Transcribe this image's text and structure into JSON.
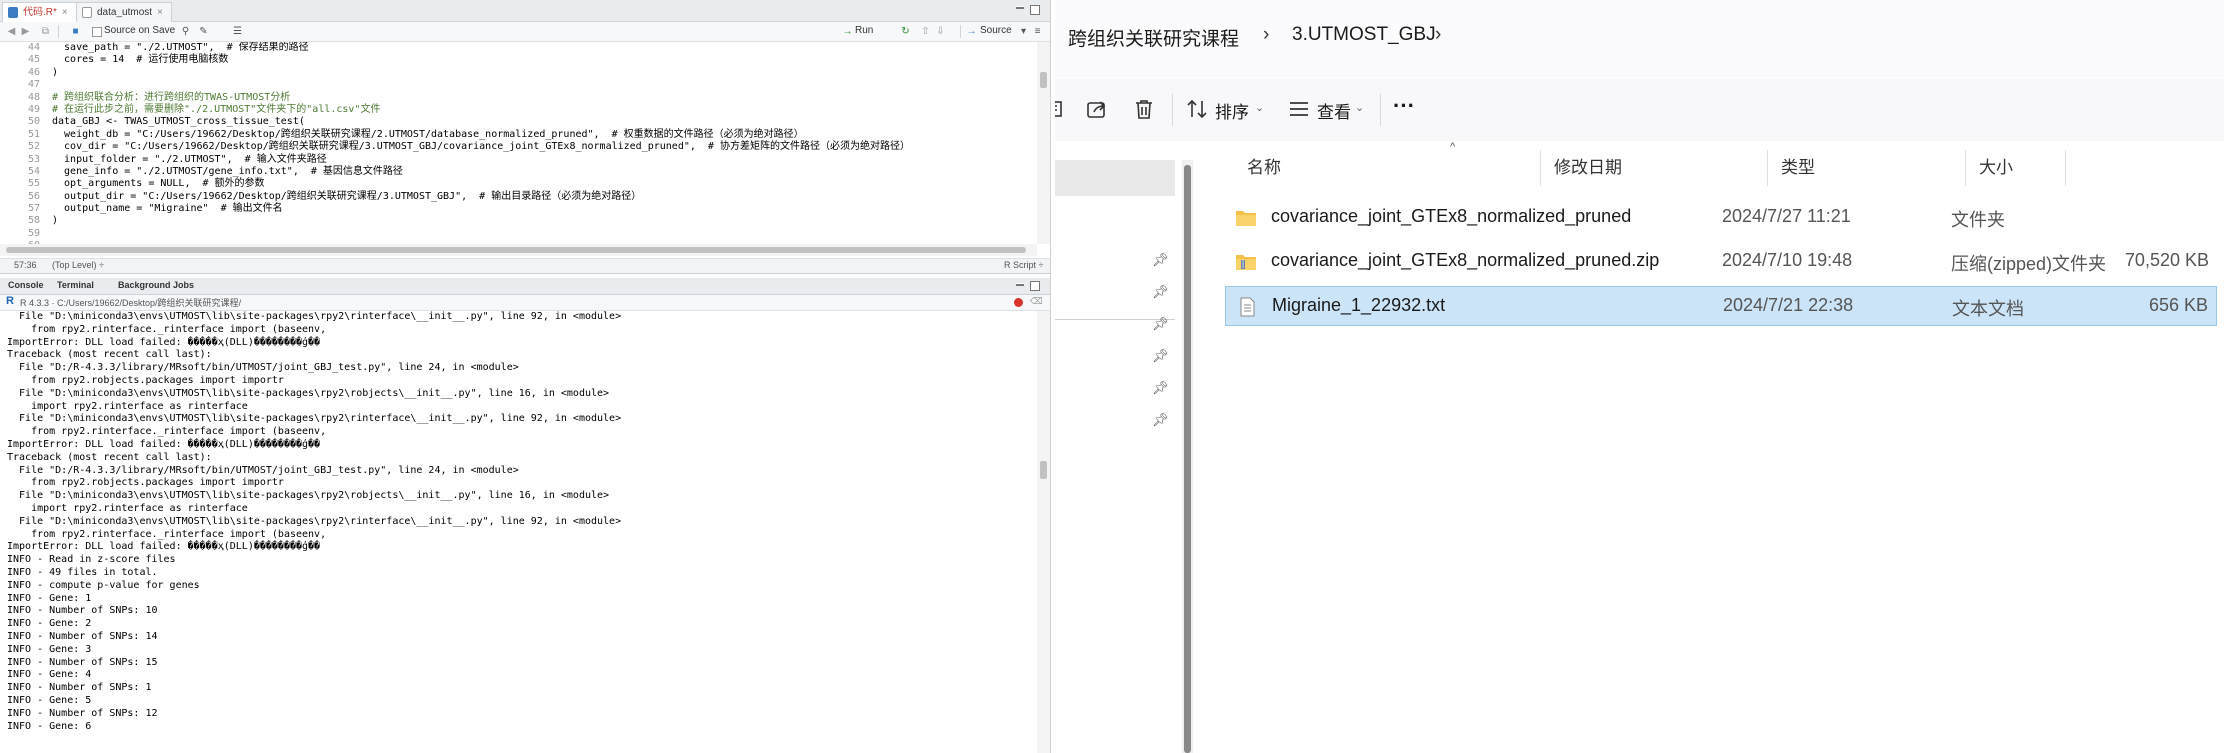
{
  "rstudio": {
    "tabs": [
      {
        "label": "代码.R*",
        "active": true
      },
      {
        "label": "data_utmost",
        "active": false
      }
    ],
    "toolbar": {
      "source_on_save": "Source on Save",
      "run": "Run",
      "source": "Source"
    },
    "editor": {
      "line_numbers": [
        "44",
        "45",
        "46",
        "47",
        "48",
        "49",
        "50",
        "51",
        "52",
        "53",
        "54",
        "55",
        "56",
        "57",
        "58",
        "59",
        "60"
      ],
      "lines": [
        "  save_path = \"./2.UTMOST\",  # 保存结果的路径",
        "  cores = 14  # 运行使用电脑核数",
        ")",
        "",
        "# 跨组织联合分析：进行跨组织的TWAS-UTMOST分析",
        "# 在运行此步之前，需要删除\"./2.UTMOST\"文件夹下的\"all.csv\"文件",
        "data_GBJ <- TWAS_UTMOST_cross_tissue_test(",
        "  weight_db = \"C:/Users/19662/Desktop/跨组织关联研究课程/2.UTMOST/database_normalized_pruned\",  # 权重数据的文件路径（必须为绝对路径）",
        "  cov_dir = \"C:/Users/19662/Desktop/跨组织关联研究课程/3.UTMOST_GBJ/covariance_joint_GTEx8_normalized_pruned\",  # 协方差矩阵的文件路径（必须为绝对路径）",
        "  input_folder = \"./2.UTMOST\",  # 输入文件夹路径",
        "  gene_info = \"./2.UTMOST/gene_info.txt\",  # 基因信息文件路径",
        "  opt_arguments = NULL,  # 额外的参数",
        "  output_dir = \"C:/Users/19662/Desktop/跨组织关联研究课程/3.UTMOST_GBJ\",  # 输出目录路径（必须为绝对路径）",
        "  output_name = \"Migraine\"  # 输出文件名",
        ")",
        "",
        ""
      ]
    },
    "status": {
      "position": "57:36",
      "scope": "(Top Level) ÷",
      "filetype": "R Script ÷"
    },
    "console_tabs": [
      "Console",
      "Terminal",
      "Background Jobs"
    ],
    "console_path": "R 4.3.3 · C:/Users/19662/Desktop/跨组织关联研究课程/",
    "console_lines": [
      "  File \"D:\\miniconda3\\envs\\UTMOST\\lib\\site-packages\\rpy2\\rinterface\\__init__.py\", line 92, in <module>",
      "    from rpy2.rinterface._rinterface import (baseenv,",
      "ImportError: DLL load failed: �����ҳ(DLL)��������ģ��",
      "Traceback (most recent call last):",
      "  File \"D:/R-4.3.3/library/MRsoft/bin/UTMOST/joint_GBJ_test.py\", line 24, in <module>",
      "    from rpy2.robjects.packages import importr",
      "  File \"D:\\miniconda3\\envs\\UTMOST\\lib\\site-packages\\rpy2\\robjects\\__init__.py\", line 16, in <module>",
      "    import rpy2.rinterface as rinterface",
      "  File \"D:\\miniconda3\\envs\\UTMOST\\lib\\site-packages\\rpy2\\rinterface\\__init__.py\", line 92, in <module>",
      "    from rpy2.rinterface._rinterface import (baseenv,",
      "ImportError: DLL load failed: �����ҳ(DLL)��������ģ��",
      "Traceback (most recent call last):",
      "  File \"D:/R-4.3.3/library/MRsoft/bin/UTMOST/joint_GBJ_test.py\", line 24, in <module>",
      "    from rpy2.robjects.packages import importr",
      "  File \"D:\\miniconda3\\envs\\UTMOST\\lib\\site-packages\\rpy2\\robjects\\__init__.py\", line 16, in <module>",
      "    import rpy2.rinterface as rinterface",
      "  File \"D:\\miniconda3\\envs\\UTMOST\\lib\\site-packages\\rpy2\\rinterface\\__init__.py\", line 92, in <module>",
      "    from rpy2.rinterface._rinterface import (baseenv,",
      "ImportError: DLL load failed: �����ҳ(DLL)��������ģ��",
      "INFO - Read in z-score files",
      "INFO - 49 files in total.",
      "INFO - compute p-value for genes",
      "INFO - Gene: 1",
      "INFO - Number of SNPs: 10",
      "INFO - Gene: 2",
      "INFO - Number of SNPs: 14",
      "INFO - Gene: 3",
      "INFO - Number of SNPs: 15",
      "INFO - Gene: 4",
      "INFO - Number of SNPs: 1",
      "INFO - Gene: 5",
      "INFO - Number of SNPs: 12",
      "INFO - Gene: 6"
    ]
  },
  "explorer": {
    "breadcrumb": [
      "跨组织关联研究课程",
      "3.UTMOST_GBJ"
    ],
    "commands": {
      "sort": "排序",
      "view": "查看",
      "more": "···"
    },
    "columns": {
      "name": "名称",
      "date": "修改日期",
      "type": "类型",
      "size": "大小"
    },
    "files": [
      {
        "name": "covariance_joint_GTEx8_normalized_pruned",
        "date": "2024/7/27 11:21",
        "type": "文件夹",
        "size": "",
        "icon": "folder-icon",
        "selected": false
      },
      {
        "name": "covariance_joint_GTEx8_normalized_pruned.zip",
        "date": "2024/7/10 19:48",
        "type": "压缩(zipped)文件夹",
        "size": "70,520 KB",
        "icon": "zip-folder-icon",
        "selected": false
      },
      {
        "name": "Migraine_1_22932.txt",
        "date": "2024/7/21 22:38",
        "type": "文本文档",
        "size": "656 KB",
        "icon": "text-file-icon",
        "selected": true
      }
    ]
  }
}
